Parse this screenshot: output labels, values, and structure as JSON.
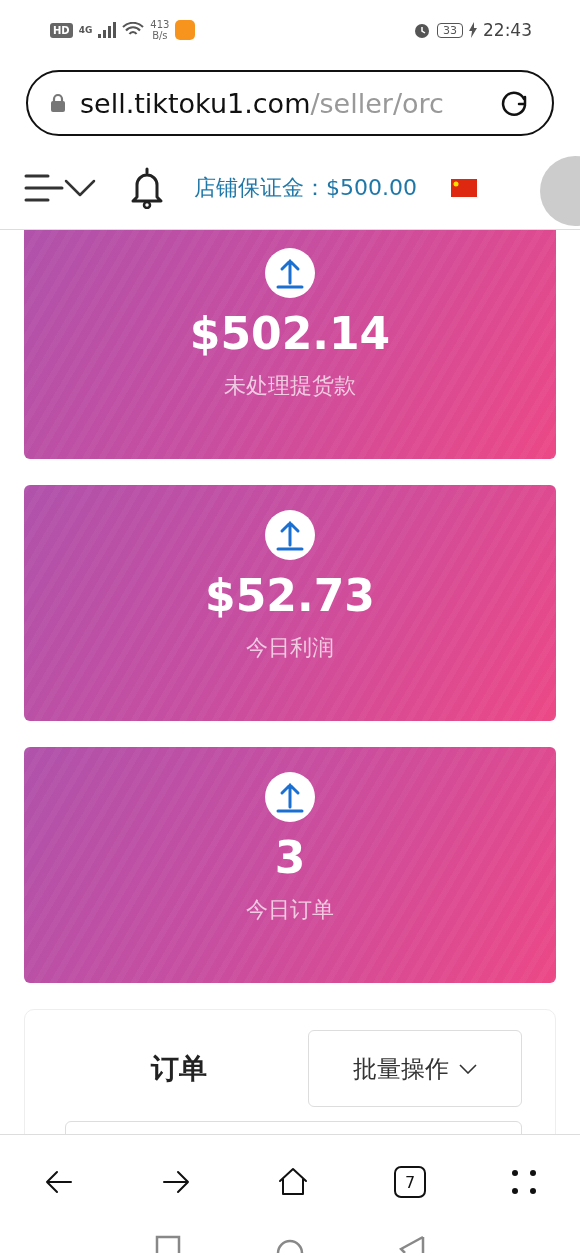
{
  "status_bar": {
    "hd": "HD",
    "network": "4G",
    "speed_value": "413",
    "speed_unit": "B/s",
    "battery": "33",
    "time": "22:43"
  },
  "address_bar": {
    "domain": "sell.tiktoku1.com",
    "path": "/seller/orc"
  },
  "header": {
    "deposit": "店铺保证金：$500.00"
  },
  "stats": [
    {
      "amount": "$502.14",
      "label": "未处理提货款"
    },
    {
      "amount": "$52.73",
      "label": "今日利润"
    },
    {
      "amount": "3",
      "label": "今日订单"
    }
  ],
  "orders": {
    "title": "订单",
    "bulk_button": "批量操作"
  },
  "toolbar": {
    "tab_count": "7"
  }
}
